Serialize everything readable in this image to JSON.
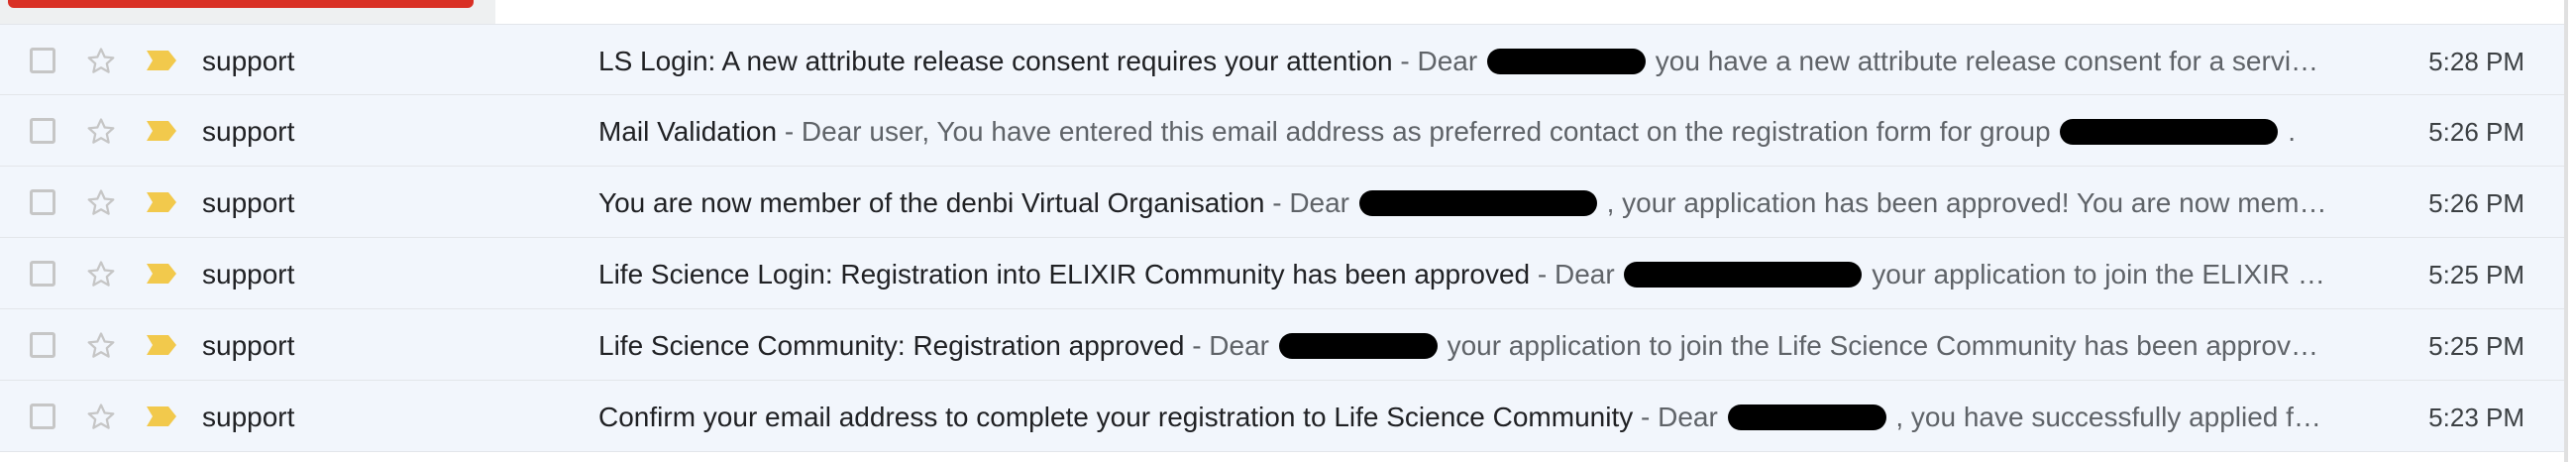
{
  "colors": {
    "accent_red": "#d93025",
    "row_bg": "#f2f6fc",
    "importance_yellow": "#f2c94c",
    "star_outline": "#c6c6c6"
  },
  "icons": {
    "checkbox": "checkbox-icon",
    "star": "star-outline-icon",
    "importance": "importance-marker-icon"
  },
  "emails": [
    {
      "sender": "support",
      "subject": "LS Login: A new attribute release consent requires your attention",
      "snippet_before": "Dear",
      "snippet_after": "you have a new attribute release consent for a servi…",
      "time": "5:28 PM"
    },
    {
      "sender": "support",
      "subject": "Mail Validation",
      "snippet_before": "Dear user, You have entered this email address as preferred contact on the registration form for group",
      "snippet_after": ".",
      "time": "5:26 PM"
    },
    {
      "sender": "support",
      "subject": "You are now member of the denbi Virtual Organisation",
      "snippet_before": "Dear",
      "snippet_after": ", your application has been approved! You are now mem…",
      "time": "5:26 PM"
    },
    {
      "sender": "support",
      "subject": "Life Science Login: Registration into ELIXIR Community has been approved",
      "snippet_before": "Dear",
      "snippet_after": "your application to join the ELIXIR …",
      "time": "5:25 PM"
    },
    {
      "sender": "support",
      "subject": "Life Science Community: Registration approved",
      "snippet_before": "Dear",
      "snippet_after": "your application to join the Life Science Community has been approv…",
      "time": "5:25 PM"
    },
    {
      "sender": "support",
      "subject": "Confirm your email address to complete your registration to Life Science Community",
      "snippet_before": "Dear",
      "snippet_after": ", you have successfully applied f…",
      "time": "5:23 PM"
    }
  ]
}
